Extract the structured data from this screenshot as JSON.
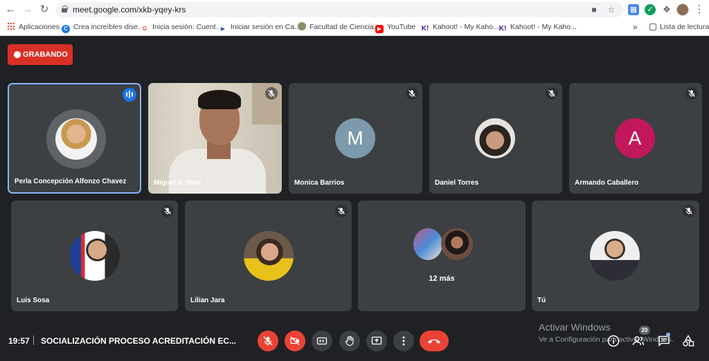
{
  "browser": {
    "url": "meet.google.com/xkb-yqey-krs",
    "bookmarks": [
      {
        "label": "Aplicaciones",
        "icon": "apps-grid-icon"
      },
      {
        "label": "Crea increíbles dise...",
        "icon": "canva-icon",
        "color": "#1a73e8"
      },
      {
        "label": "Inicia sesión: Cuent...",
        "icon": "google-icon",
        "color": "#ea4335"
      },
      {
        "label": "Iniciar sesión en Ca...",
        "icon": "play-icon",
        "color": "#3c4bd3"
      },
      {
        "label": "Facultad de Ciencia...",
        "icon": "seal-icon",
        "color": "#8d8d6a"
      },
      {
        "label": "YouTube",
        "icon": "youtube-icon",
        "color": "#ff0000"
      },
      {
        "label": "Kahoot! - My Kaho...",
        "icon": "kahoot-icon",
        "color": "#46178f"
      },
      {
        "label": "Kahoot! - My Kaho...",
        "icon": "kahoot-icon",
        "color": "#46178f"
      }
    ],
    "bookmarks_more": "»",
    "reading_list": "Lista de lectura"
  },
  "meet": {
    "recording_label": "GRABANDO",
    "row1": [
      {
        "name": "Perla Concepción Alfonzo Chavez",
        "speaking": true
      },
      {
        "name": "Miguel A. Vora",
        "video": true
      },
      {
        "name": "Monica Barrios",
        "letter": "M",
        "color": "#7c9aab"
      },
      {
        "name": "Daniel Torres"
      },
      {
        "name": "Armando Caballero",
        "letter": "A",
        "color": "#c2185b"
      }
    ],
    "row2": [
      {
        "name": "Luis Sosa"
      },
      {
        "name": "Lilian Jara"
      },
      {
        "name": "12 más"
      },
      {
        "name": "Tú"
      }
    ]
  },
  "bottom": {
    "time": "19:57",
    "meeting_title": "SOCIALIZACIÓN PROCESO ACREDITACIÓN EC...",
    "participants_count": "20",
    "watermark_title": "Activar Windows",
    "watermark_sub": "Ve a Configuración para activar Windows."
  },
  "colors": {
    "background": "#202124",
    "tile": "#3c4043",
    "danger": "#ea4335",
    "accent": "#8ab4f8"
  }
}
